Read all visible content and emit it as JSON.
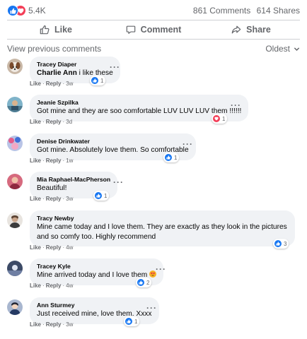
{
  "stats": {
    "reactions": "5.4K",
    "comments": "861 Comments",
    "shares": "614 Shares"
  },
  "actions": {
    "like": "Like",
    "comment": "Comment",
    "share": "Share"
  },
  "comments_header": {
    "previous": "View previous comments",
    "sort": "Oldest"
  },
  "meta_labels": {
    "like": "Like",
    "reply": "Reply",
    "sep": "·",
    "dots": "···"
  },
  "colors": {
    "like_blue": "#1877f2",
    "love_red": "#f33e58",
    "bubble": "#f0f2f5",
    "muted": "#65676b"
  },
  "comments": [
    {
      "author": "Tracey Diaper",
      "tag": "Charlie Ann",
      "text": " i like these",
      "time": "3w",
      "reactions": "1",
      "reaction_type": "like"
    },
    {
      "author": "Jeanie Szpilka",
      "text": "Got mine and they are soo comfortable LUV LUV LUV them !!!!!!",
      "time": "3d",
      "reactions": "1",
      "reaction_type": "love"
    },
    {
      "author": "Denise Drinkwater",
      "text": "Got mine. Absolutely love them. So comfortable",
      "time": "1w",
      "reactions": "1",
      "reaction_type": "like"
    },
    {
      "author": "Mia Raphael-MacPherson",
      "text": "Beautiful!",
      "time": "3w",
      "reactions": "1",
      "reaction_type": "like"
    },
    {
      "author": "Tracy Newby",
      "text": "Mine came today and I love them. They are exactly as they look in the pictures and so comfy too. Highly recommend",
      "time": "4w",
      "reactions": "3",
      "reaction_type": "like"
    },
    {
      "author": "Tracey Kyle",
      "text": "Mine arrived today and I love them",
      "emoji": "heart-eyes-emoji",
      "time": "4w",
      "reactions": "2",
      "reaction_type": "like"
    },
    {
      "author": "Ann Sturmey",
      "text": "Just received mine, love them. Xxxx",
      "time": "3w",
      "reactions": "1",
      "reaction_type": "like"
    }
  ]
}
